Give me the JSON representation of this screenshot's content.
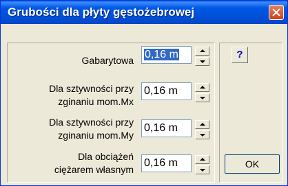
{
  "window": {
    "title": "Grubości dla płyty gęstożebrowej"
  },
  "fields": [
    {
      "label_lines": [
        "Gabarytowa"
      ],
      "value": "0,16 m",
      "selected": true
    },
    {
      "label_lines": [
        "Dla sztywności przy",
        "zginaniu mom.Mx"
      ],
      "value": "0,16 m",
      "selected": false
    },
    {
      "label_lines": [
        "Dla sztywności przy",
        "zginaniu mom.My"
      ],
      "value": "0,16 m",
      "selected": false
    },
    {
      "label_lines": [
        "Dla obciążeń",
        "ciężarem własnym"
      ],
      "value": "0,16 m",
      "selected": false
    }
  ],
  "buttons": {
    "help_label": "?",
    "ok_label": "OK"
  },
  "colors": {
    "titlebar": "#0058e6",
    "dialog_bg": "#ece9d8",
    "selection": "#316ac5",
    "close": "#c8411a"
  }
}
